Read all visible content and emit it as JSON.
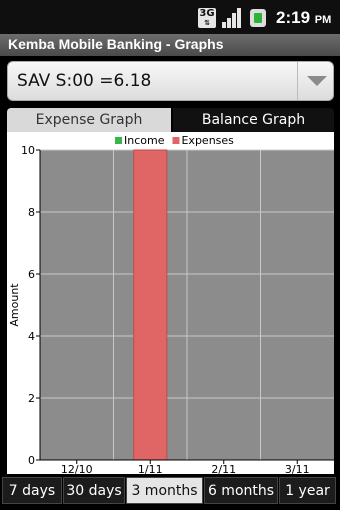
{
  "status_bar": {
    "network": "3G",
    "time": "2:19",
    "ampm": "PM",
    "icons": [
      "data-3g-icon",
      "signal-icon",
      "battery-icon"
    ]
  },
  "app": {
    "title": "Kemba Mobile Banking - Graphs"
  },
  "account_selector": {
    "selected": "SAV S:00 =6.18"
  },
  "tabs": [
    {
      "label": "Expense Graph",
      "selected": false
    },
    {
      "label": "Balance Graph",
      "selected": true
    }
  ],
  "chart_data": {
    "type": "bar",
    "categories": [
      "12/10",
      "1/11",
      "2/11",
      "3/11"
    ],
    "series": [
      {
        "name": "Income",
        "color": "#39b54a",
        "values": [
          0,
          0,
          0,
          0
        ]
      },
      {
        "name": "Expenses",
        "color": "#e06666",
        "values": [
          0,
          10,
          0,
          0
        ]
      }
    ],
    "ylabel": "Amount",
    "xlabel": "",
    "ylim": [
      0,
      10
    ],
    "yticks": [
      0,
      2,
      4,
      6,
      8,
      10
    ],
    "grid": true,
    "legend": "top-center",
    "plot_background": "#8c8c8c"
  },
  "range_buttons": [
    {
      "label": "7 days",
      "selected": false
    },
    {
      "label": "30 days",
      "selected": false
    },
    {
      "label": "3 months",
      "selected": true
    },
    {
      "label": "6 months",
      "selected": false
    },
    {
      "label": "1 year",
      "selected": false
    }
  ]
}
